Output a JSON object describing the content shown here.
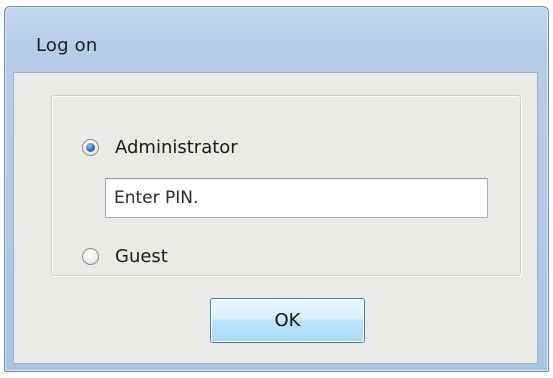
{
  "window": {
    "title": "Log on"
  },
  "logon": {
    "options": [
      {
        "label": "Administrator",
        "checked": true
      },
      {
        "label": "Guest",
        "checked": false
      }
    ],
    "pin": {
      "value": "",
      "placeholder": "Enter PIN."
    }
  },
  "footer": {
    "ok_label": "OK"
  },
  "colors": {
    "titlebar": "#b7cde8",
    "client_background": "#eceae6",
    "ok_button": "#bee6fd",
    "radio_selected": "#2d73c0"
  }
}
